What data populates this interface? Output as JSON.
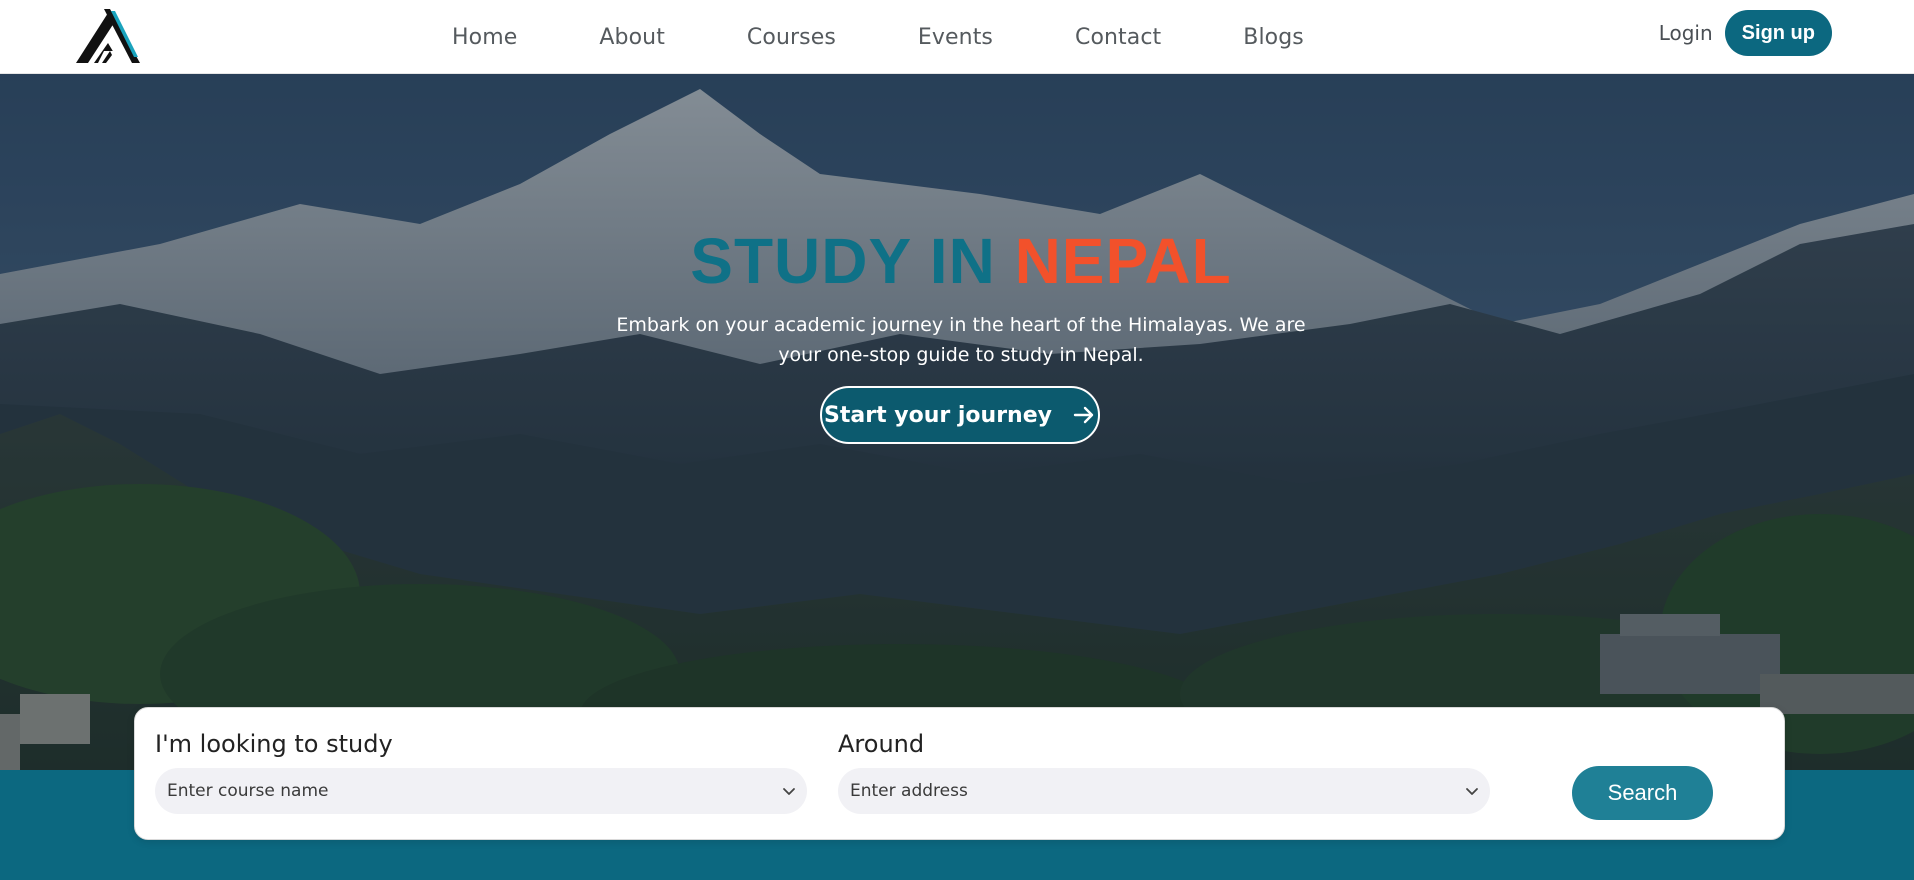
{
  "header": {
    "logo_name": "triangle-logo",
    "nav": [
      {
        "label": "Home"
      },
      {
        "label": "About"
      },
      {
        "label": "Courses"
      },
      {
        "label": "Events"
      },
      {
        "label": "Contact"
      },
      {
        "label": "Blogs"
      }
    ],
    "login_label": "Login",
    "signup_label": "Sign up"
  },
  "hero": {
    "title_part1": "STUDY IN",
    "title_part2": "NEPAL",
    "description": "Embark on your academic journey in the heart of the Himalayas. We are your one-stop guide to study in Nepal.",
    "cta_label": "Start your journey",
    "cta_icon": "arrow-right-icon"
  },
  "search": {
    "study_label": "I'm looking to study",
    "study_placeholder": "Enter course name",
    "around_label": "Around",
    "around_placeholder": "Enter address",
    "button_label": "Search"
  },
  "colors": {
    "brand_teal": "#0c6880",
    "title_teal": "#0f7187",
    "title_orange": "#f2512b",
    "search_button": "#1f8096"
  }
}
